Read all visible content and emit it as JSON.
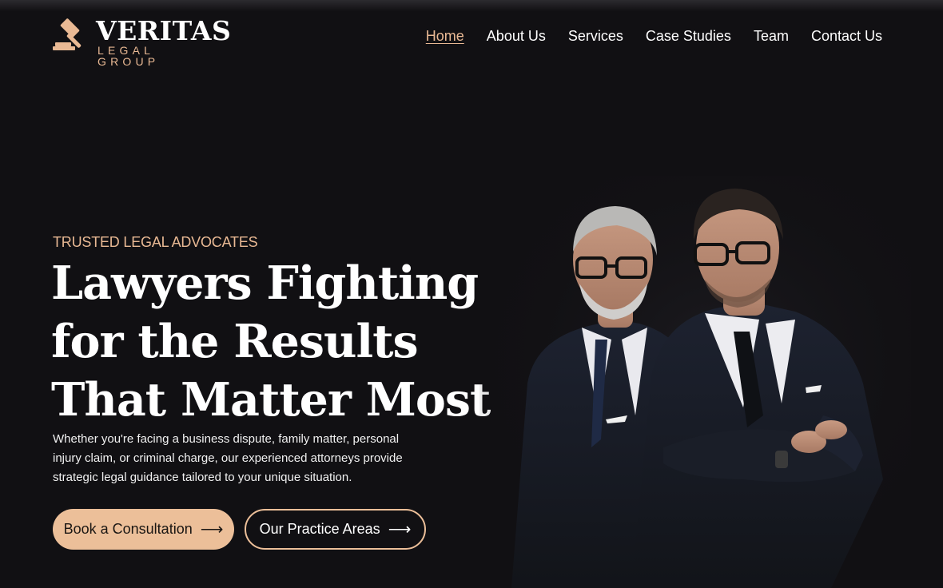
{
  "brand": {
    "name": "VERITAS",
    "tagline": "LEGAL GROUP",
    "icon": "gavel-icon",
    "accent_color": "#e9b994"
  },
  "nav": {
    "items": [
      {
        "label": "Home",
        "active": true
      },
      {
        "label": "About Us",
        "active": false
      },
      {
        "label": "Services",
        "active": false
      },
      {
        "label": "Case Studies",
        "active": false
      },
      {
        "label": "Team",
        "active": false
      },
      {
        "label": "Contact Us",
        "active": false
      }
    ]
  },
  "hero": {
    "eyebrow": "TRUSTED LEGAL ADVOCATES",
    "headline_lines": [
      "Lawyers Fighting",
      "for the Results",
      "That Matter Most"
    ],
    "lead": "Whether you're facing a business dispute, family matter, personal injury claim, or criminal charge, our experienced attorneys provide strategic legal guidance tailored to your unique situation.",
    "primary_cta": {
      "label": "Book a Consultation",
      "icon": "arrow-right-icon"
    },
    "secondary_cta": {
      "label": "Our Practice Areas",
      "icon": "arrow-right-icon"
    },
    "image": "two-attorneys-photo"
  },
  "colors": {
    "background": "#111013",
    "accent": "#ecbf99",
    "text": "#ffffff"
  }
}
